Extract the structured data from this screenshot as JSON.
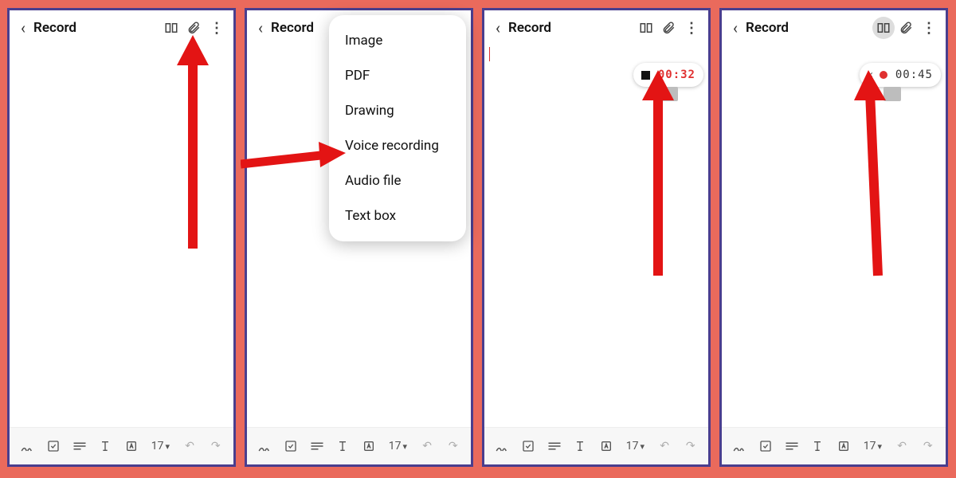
{
  "header": {
    "title": "Record"
  },
  "menu": {
    "items": [
      {
        "label": "Image"
      },
      {
        "label": "PDF"
      },
      {
        "label": "Drawing"
      },
      {
        "label": "Voice recording"
      },
      {
        "label": "Audio file"
      },
      {
        "label": "Text box"
      }
    ]
  },
  "recording": {
    "panel3_time": "00:32",
    "panel4_time": "00:45"
  },
  "toolbar": {
    "font_size": "17",
    "caret": "▾"
  }
}
